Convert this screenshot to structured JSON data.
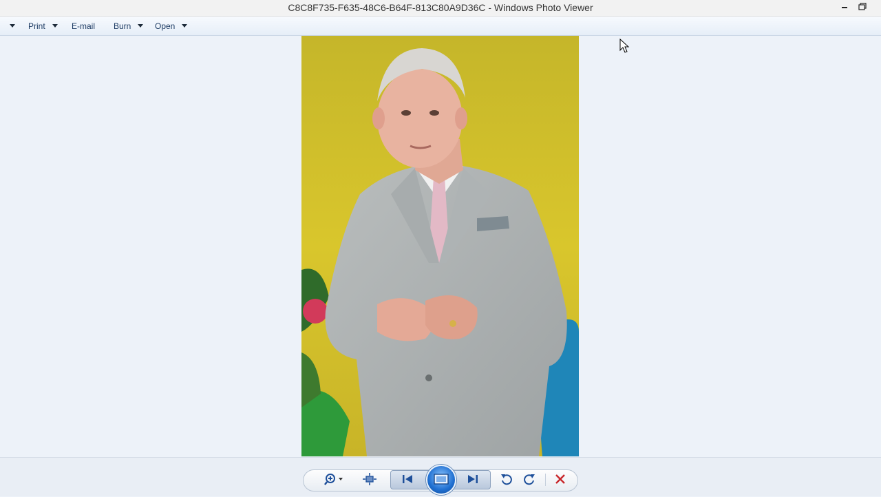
{
  "window": {
    "title": "C8C8F735-F635-48C6-B64F-813C80A9D36C - Windows Photo Viewer"
  },
  "menu": {
    "items": [
      {
        "label": ""
      },
      {
        "label": "Print"
      },
      {
        "label": "E-mail"
      },
      {
        "label": "Burn"
      },
      {
        "label": "Open"
      }
    ]
  },
  "toolbar": {
    "buttons": [
      "zoom-icon",
      "actual-size-icon",
      "previous-icon",
      "slideshow-icon",
      "next-icon",
      "rotate-ccw-icon",
      "rotate-cw-icon",
      "delete-icon"
    ]
  },
  "colors": {
    "background": "#edf2f9",
    "accent": "#1f6fd1",
    "delete": "#c8262a",
    "photo_backdrop": "#c8bb2a"
  }
}
